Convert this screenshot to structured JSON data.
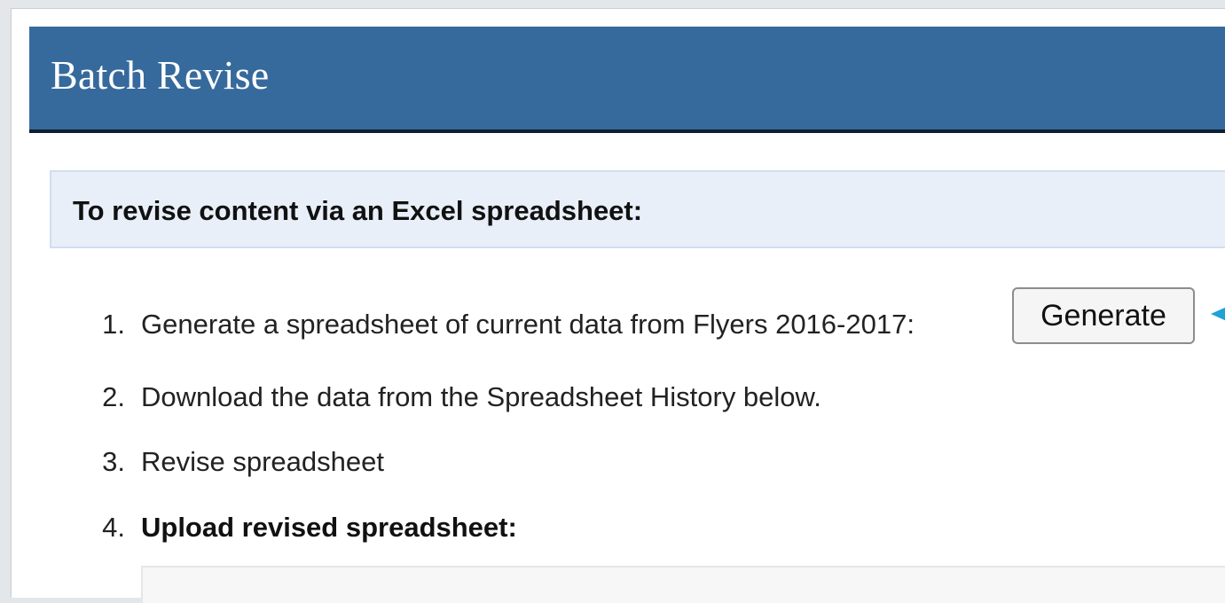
{
  "header": {
    "title": "Batch Revise"
  },
  "instructions": {
    "heading": "To revise content via an Excel spreadsheet:"
  },
  "steps": [
    {
      "number": "1.",
      "text": "Generate a spreadsheet of current data from Flyers 2016-2017:"
    },
    {
      "number": "2.",
      "text": "Download the data from the Spreadsheet History below."
    },
    {
      "number": "3.",
      "text": "Revise spreadsheet"
    },
    {
      "number": "4.",
      "text": "Upload revised spreadsheet:"
    }
  ],
  "actions": {
    "generate_label": "Generate"
  },
  "colors": {
    "header_bg": "#366a9c",
    "instruction_bg": "#e8eff9",
    "arrow": "#1fa3d6"
  }
}
